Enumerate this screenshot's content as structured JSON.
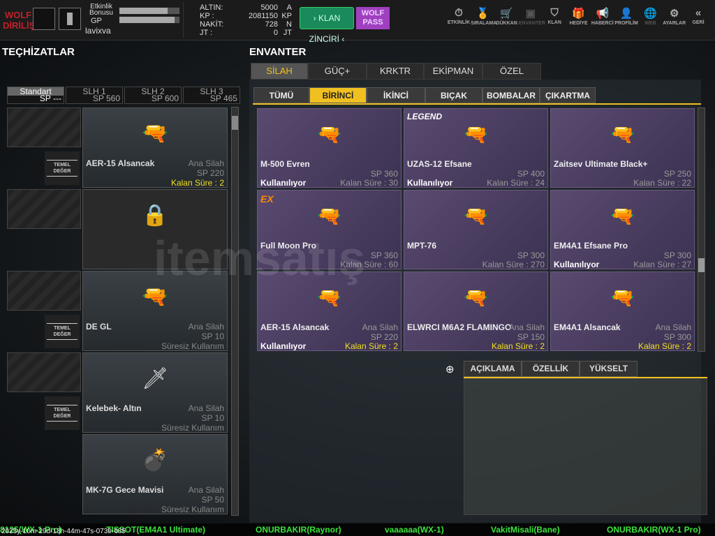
{
  "header": {
    "logo": "WOLF DİRİLİŞ",
    "event_bonus_label": "Etkinlik Bonusu",
    "gp_label": "GP",
    "username": "lavixva",
    "event_bonus_progress": 0.8,
    "gp_progress": 0.92,
    "currencies": [
      {
        "label": "ALTIN:",
        "value": "5000",
        "unit": "A"
      },
      {
        "label": "KP :",
        "value": "2081150",
        "unit": "KP"
      },
      {
        "label": "NAKİT:",
        "value": "728",
        "unit": "N"
      },
      {
        "label": "JT :",
        "value": "0",
        "unit": "JT"
      }
    ],
    "clan_chain": "› KLAN ZİNCİRİ ‹",
    "wolf_pass": "WOLF PASS",
    "nav": [
      {
        "label": "ETKİNLİK",
        "icon": "⏱"
      },
      {
        "label": "SIRALAMA",
        "icon": "🏅"
      },
      {
        "label": "DÜKKAN",
        "icon": "🛒"
      },
      {
        "label": "ENVANTER",
        "icon": "▣"
      },
      {
        "label": "KLAN",
        "icon": "⛉"
      },
      {
        "label": "HEDİYE",
        "icon": "🎁"
      },
      {
        "label": "HABERCİ",
        "icon": "📢"
      },
      {
        "label": "PROFİLİM",
        "icon": "👤"
      },
      {
        "label": "WEB",
        "icon": "🌐"
      },
      {
        "label": "AYARLAR",
        "icon": "⚙"
      },
      {
        "label": "GERİ",
        "icon": "«"
      }
    ]
  },
  "left": {
    "title": "TEÇHİZATLAR",
    "slots": [
      {
        "name": "Standart",
        "sp": "SP ---"
      },
      {
        "name": "SLH 1",
        "sp": "SP 560"
      },
      {
        "name": "SLH 2",
        "sp": "SP 600"
      },
      {
        "name": "SLH 3",
        "sp": "SP 465"
      }
    ],
    "temel": "TEMEL DEĞER",
    "items": [
      {
        "name": "AER-15 Alsancak",
        "type": "Ana Silah",
        "sp": "SP 220",
        "time": "Kalan Süre : 2",
        "icon": "🔫"
      },
      {
        "locked": true,
        "icon": "🔒"
      },
      {
        "name": "DE GL",
        "type": "Ana Silah",
        "sp": "SP 10",
        "time": "Süresiz Kullanım",
        "icon": "🔫"
      },
      {
        "name": "Kelebek- Altın",
        "type": "Ana Silah",
        "sp": "SP 10",
        "time": "Süresiz Kullanım",
        "icon": "🗡"
      },
      {
        "name": "MK-7G Gece Mavisi",
        "type": "Ana Silah",
        "sp": "SP 50",
        "time": "Süresiz Kullanım",
        "icon": "💣"
      }
    ]
  },
  "inventory": {
    "title": "ENVANTER",
    "tabs": [
      "SİLAH",
      "GÜÇ+",
      "KRKTR",
      "EKİPMAN",
      "ÖZEL"
    ],
    "subtabs": [
      "TÜMÜ",
      "BİRİNCİ",
      "İKİNCİ",
      "BIÇAK",
      "BOMBALAR",
      "ÇIKARTMA"
    ],
    "items": [
      {
        "name": "M-500 Evren",
        "type": "",
        "sp": "SP 360",
        "status": "Kullanılıyor",
        "time": "Kalan Süre : 30",
        "icon": "🔫"
      },
      {
        "name": "UZAS-12 Efsane",
        "type": "",
        "sp": "SP 400",
        "status": "Kullanılıyor",
        "time": "Kalan Süre : 24",
        "icon": "🔫",
        "badge": "LEGEND"
      },
      {
        "name": "Zaitsev Ultimate Black+",
        "type": "",
        "sp": "SP 250",
        "status": "",
        "time": "Kalan Süre : 22",
        "icon": "🔫"
      },
      {
        "name": "Full Moon Pro",
        "type": "",
        "sp": "SP 360",
        "status": "",
        "time": "Kalan Süre : 60",
        "icon": "🔫",
        "badge": "EX"
      },
      {
        "name": "MPT-76",
        "type": "",
        "sp": "SP 300",
        "status": "",
        "time": "Kalan Süre : 270",
        "icon": "🔫"
      },
      {
        "name": "EM4A1 Efsane Pro",
        "type": "",
        "sp": "SP 300",
        "status": "Kullanılıyor",
        "time": "Kalan Süre : 27",
        "icon": "🔫"
      },
      {
        "name": "AER-15 Alsancak",
        "type": "Ana Silah",
        "sp": "SP 220",
        "status": "Kullanılıyor",
        "time": "Kalan Süre : 2",
        "icon": "🔫"
      },
      {
        "name": "ELWRCI M6A2 FLAMINGO",
        "type": "Ana Silah",
        "sp": "SP 150",
        "status": "",
        "time": "Kalan Süre : 2",
        "icon": "🔫"
      },
      {
        "name": "EM4A1 Alsancak",
        "type": "Ana Silah",
        "sp": "SP 300",
        "status": "",
        "time": "Kalan Süre : 2",
        "icon": "🔫"
      }
    ],
    "detail_tabs": [
      "AÇIKLAMA",
      "ÖZELLİK",
      "YÜKSELT"
    ]
  },
  "ticker": [
    "8125(WX-1 Pro)",
    "TISSOT(EM4A1 Ultimate)",
    "ONURBAKIR(Raynor)",
    "vaaaaaa(WX-1)",
    "VakitMisali(Bane)",
    "ONURBAKIR(WX-1 Pro)"
  ],
  "timestamp": "2025y-10m-29d-13h-44m-47s-0739-685",
  "watermark": "itemsatış"
}
